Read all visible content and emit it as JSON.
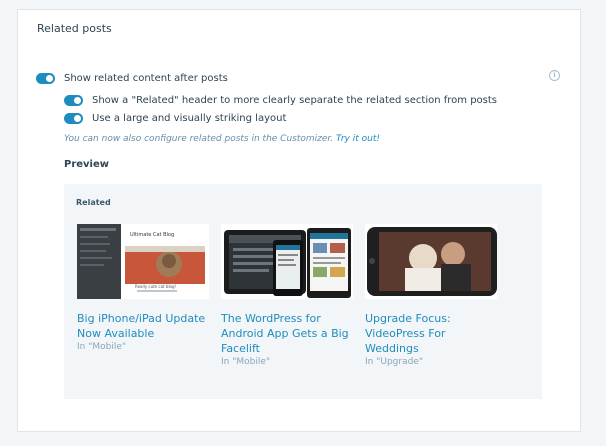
{
  "header": {
    "title": "Related posts"
  },
  "settings": {
    "show_related": {
      "label": "Show related content after posts",
      "enabled": true
    },
    "show_header": {
      "label": "Show a \"Related\" header to more clearly separate the related section from posts",
      "enabled": true
    },
    "large_layout": {
      "label": "Use a large and visually striking layout",
      "enabled": true
    },
    "customizer_note": "You can now also configure related posts in the Customizer.",
    "customizer_link": "Try it out!"
  },
  "preview": {
    "heading": "Preview",
    "related_label": "Related",
    "posts": [
      {
        "title": "Big iPhone/iPad Update Now Available",
        "category": "In \"Mobile\""
      },
      {
        "title": "The WordPress for Android App Gets a Big Facelift",
        "category": "In \"Mobile\""
      },
      {
        "title": "Upgrade Focus: VideoPress For Weddings",
        "category": "In \"Upgrade\""
      }
    ],
    "thumb_caption": "Ultimate Cat Blog",
    "thumb_subcaption": "Really cute cat blog!"
  },
  "colors": {
    "accent": "#1e8cbe",
    "text": "#2e4453",
    "muted": "#87a6bc"
  }
}
